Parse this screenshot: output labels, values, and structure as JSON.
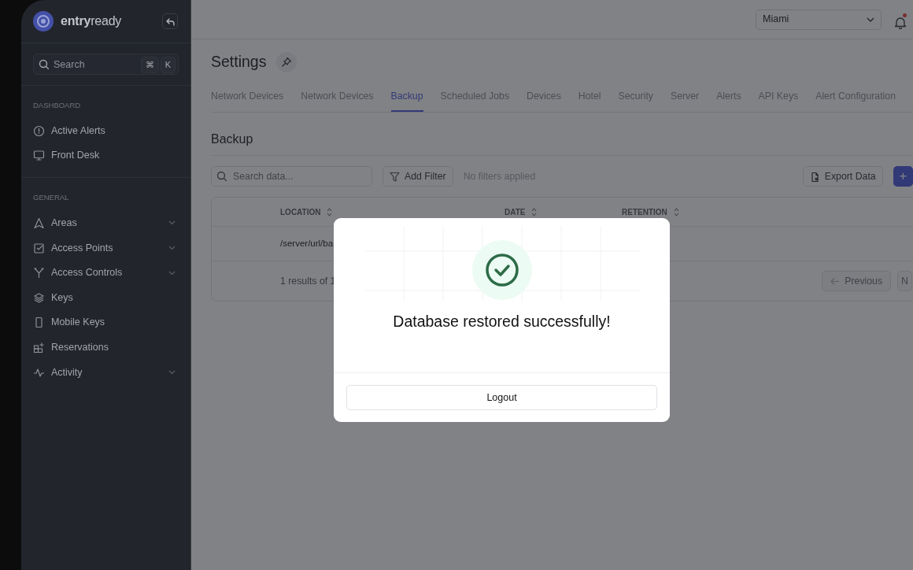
{
  "brand": {
    "name": "**entry**ready"
  },
  "sidebar": {
    "search": {
      "placeholder": "Search",
      "keys": [
        "⌘",
        "K"
      ]
    },
    "sections": [
      {
        "title": "DASHBOARD",
        "items": [
          {
            "label": "Active Alerts",
            "expandable": false
          },
          {
            "label": "Front Desk",
            "expandable": false
          }
        ]
      },
      {
        "title": "GENERAL",
        "items": [
          {
            "label": "Areas",
            "expandable": true
          },
          {
            "label": "Access Points",
            "expandable": true
          },
          {
            "label": "Access Controls",
            "expandable": true
          },
          {
            "label": "Keys",
            "expandable": false
          },
          {
            "label": "Mobile Keys",
            "expandable": false
          },
          {
            "label": "Reservations",
            "expandable": false
          },
          {
            "label": "Activity",
            "expandable": true
          }
        ]
      }
    ]
  },
  "header": {
    "location": {
      "value": "Miami"
    },
    "notifications": {
      "unread": true
    }
  },
  "page": {
    "title": "Settings",
    "tabs": [
      {
        "label": "Network Devices",
        "selected": false
      },
      {
        "label": "Network Devices",
        "selected": false
      },
      {
        "label": "Backup",
        "selected": true
      },
      {
        "label": "Scheduled Jobs",
        "selected": false
      },
      {
        "label": "Devices",
        "selected": false
      },
      {
        "label": "Hotel",
        "selected": false
      },
      {
        "label": "Security",
        "selected": false
      },
      {
        "label": "Server",
        "selected": false
      },
      {
        "label": "Alerts",
        "selected": false
      },
      {
        "label": "API Keys",
        "selected": false
      },
      {
        "label": "Alert Configuration",
        "selected": false
      }
    ],
    "section_title": "Backup",
    "toolbar": {
      "search": {
        "placeholder": "Search data..."
      },
      "filter_button": "Add Filter",
      "filter_status": "No filters applied",
      "export_button": "Export Data",
      "add_button": "+"
    },
    "table": {
      "columns": [
        "LOCATION",
        "DATE",
        "RETENTION"
      ],
      "rows": [
        [
          "/server/url/ba"
        ]
      ],
      "footer": {
        "summary": "1 results of 1",
        "previous": {
          "label": "Previous",
          "disabled": true
        },
        "next": {
          "label": "N",
          "disabled": true
        }
      }
    }
  },
  "modal": {
    "message": "Database restored successfully!",
    "button": "Logout"
  }
}
